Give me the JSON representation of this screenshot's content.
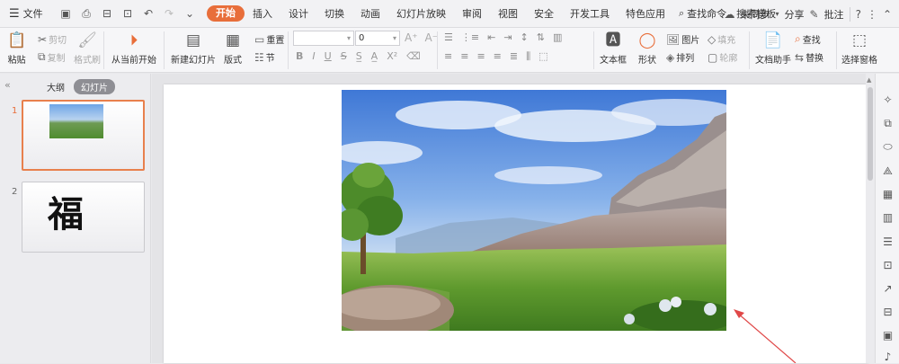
{
  "menu": {
    "file_label": "文件",
    "tabs": [
      {
        "label": "开始",
        "active": true
      },
      {
        "label": "插入"
      },
      {
        "label": "设计"
      },
      {
        "label": "切换"
      },
      {
        "label": "动画"
      },
      {
        "label": "幻灯片放映"
      },
      {
        "label": "审阅"
      },
      {
        "label": "视图"
      },
      {
        "label": "安全"
      },
      {
        "label": "开发工具"
      },
      {
        "label": "特色应用"
      }
    ],
    "search_label": "查找命令、搜索模板",
    "sync_label": "未同步",
    "share_label": "分享",
    "comment_label": "批注",
    "help": "?"
  },
  "ribbon": {
    "paste": "粘贴",
    "cut": "剪切",
    "copy": "复制",
    "format_painter": "格式刷",
    "from_current": "从当前开始",
    "new_slide": "新建幻灯片",
    "layout": "版式",
    "reset": "重置",
    "section": "节",
    "font_size": "0",
    "textbox": "文本框",
    "shape": "形状",
    "picture": "图片",
    "fill": "填充",
    "arrange": "排列",
    "outline": "轮廓",
    "doc_helper": "文档助手",
    "find": "查找",
    "replace": "替换",
    "select_pane": "选择窗格"
  },
  "panel": {
    "outline_tab": "大纲",
    "slides_tab": "幻灯片",
    "slides": [
      {
        "number": "1"
      },
      {
        "number": "2",
        "text": "福"
      }
    ]
  },
  "colors": {
    "accent": "#e86e3a",
    "selection_border": "#e8804d",
    "annotation_arrow": "#e04848"
  }
}
